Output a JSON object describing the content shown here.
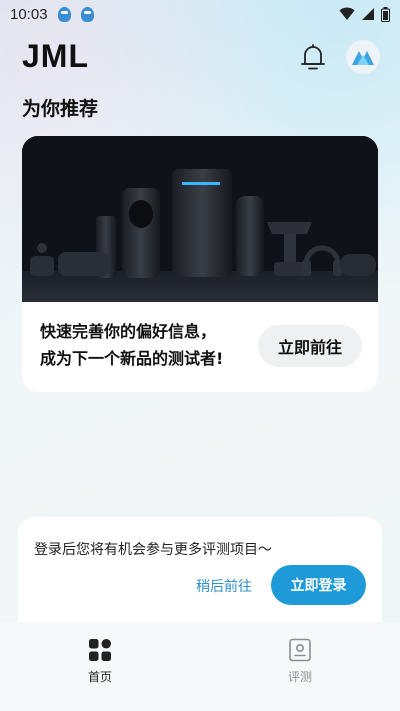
{
  "status_bar": {
    "time": "10:03",
    "icons": [
      "qq-icon",
      "qq-icon",
      "wifi-icon",
      "signal-icon",
      "battery-icon"
    ]
  },
  "header": {
    "title": "JML",
    "bell_icon": "bell-icon",
    "avatar_icon": "brand-logo-icon"
  },
  "section": {
    "title": "为你推荐"
  },
  "recommend_card": {
    "line1": "快速完善你的偏好信息，",
    "line2": "成为下一个新品的测试者!",
    "button_label": "立即前往"
  },
  "login_card": {
    "message": "登录后您将有机会参与更多评测项目～",
    "later_label": "稍后前往",
    "login_label": "立即登录"
  },
  "bottom_nav": {
    "items": [
      {
        "label": "首页",
        "icon": "home-grid-icon",
        "active": true
      },
      {
        "label": "评测",
        "icon": "review-icon",
        "active": false
      }
    ]
  },
  "colors": {
    "accent": "#1f9ad8",
    "link": "#2f8fc6",
    "banner_bg": "#12151b"
  }
}
